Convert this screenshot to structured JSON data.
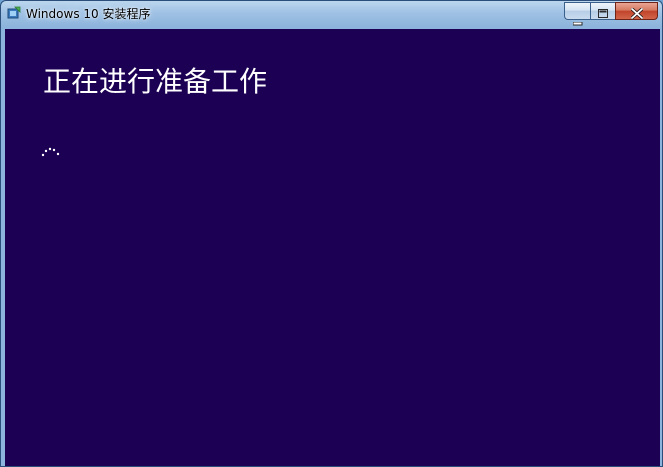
{
  "window": {
    "title": "Windows 10 安装程序",
    "icon": "setup-app-icon",
    "buttons": {
      "minimize_icon": "minimize-icon",
      "maximize_icon": "maximize-icon",
      "close_icon": "close-icon"
    }
  },
  "main": {
    "heading": "正在进行准备工作",
    "spinner_icon": "loading-spinner-icon",
    "background_color": "#1c0054",
    "text_color": "#ffffff"
  }
}
